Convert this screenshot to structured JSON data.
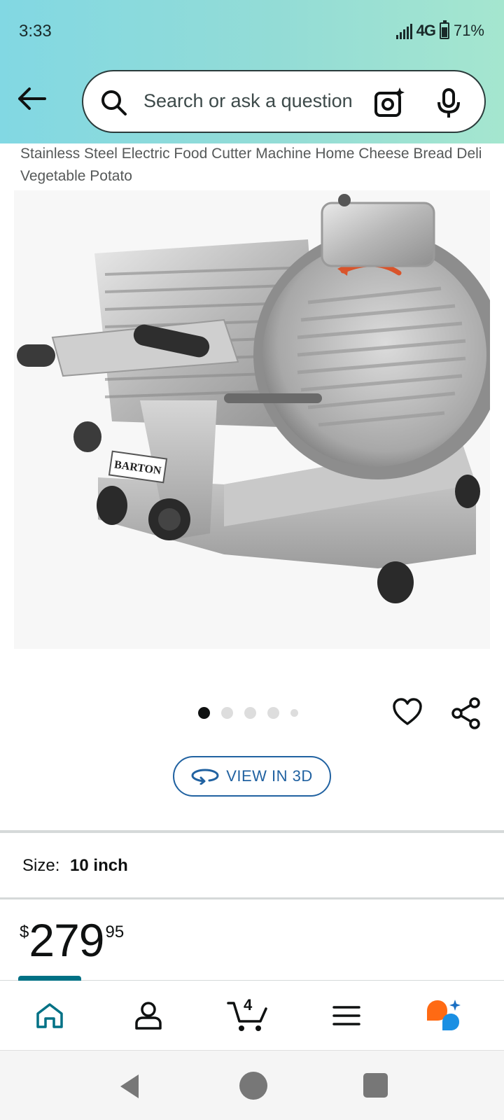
{
  "status_bar": {
    "time": "3:33",
    "network": "4G",
    "battery": "71%"
  },
  "search": {
    "placeholder": "Search or ask a question",
    "value": ""
  },
  "product": {
    "title": "Stainless Steel Electric Food Cutter Machine Home Cheese Bread Deli Vegetable Potato",
    "image_brand_label": "BARTON",
    "image_count": 5,
    "active_image_index": 0,
    "view_3d_label": "VIEW IN 3D",
    "size_label": "Size:",
    "size_value": "10 inch",
    "price": {
      "symbol": "$",
      "whole": "279",
      "fraction": "95"
    }
  },
  "bottom_nav": {
    "items": [
      {
        "name": "home",
        "icon": "home-icon",
        "active": true
      },
      {
        "name": "account",
        "icon": "person-icon",
        "active": false
      },
      {
        "name": "cart",
        "icon": "cart-icon",
        "active": false,
        "count": "4"
      },
      {
        "name": "menu",
        "icon": "hamburger-menu-icon",
        "active": false
      },
      {
        "name": "rufus",
        "icon": "rufus-assistant-icon",
        "active": false
      }
    ]
  },
  "colors": {
    "header_gradient_start": "#82d8e3",
    "header_gradient_end": "#a5e6cf",
    "link_blue": "#2162a1",
    "active_teal": "#007185",
    "rufus_orange": "#ff6a13",
    "rufus_blue": "#1a8fe3"
  }
}
